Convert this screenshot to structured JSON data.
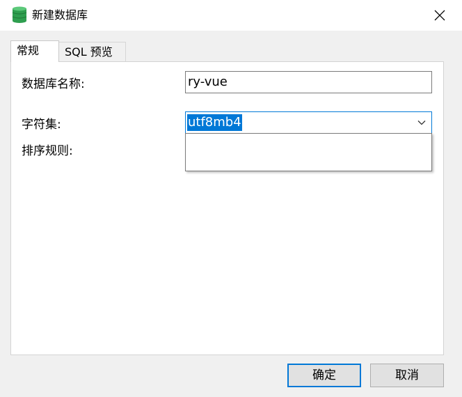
{
  "window": {
    "title": "新建数据库",
    "icon": "database-icon",
    "close_icon": "close-icon"
  },
  "tabs": [
    {
      "label": "常规",
      "active": true
    },
    {
      "label": "SQL 预览",
      "active": false
    }
  ],
  "form": {
    "name_label": "数据库名称:",
    "name_value": "ry-vue",
    "charset_label": "字符集:",
    "charset_value": "utf8mb4",
    "collation_label": "排序规则:"
  },
  "buttons": {
    "ok": "确定",
    "cancel": "取消"
  },
  "colors": {
    "accent": "#0078d7",
    "db_icon": "#2e9e4f"
  }
}
